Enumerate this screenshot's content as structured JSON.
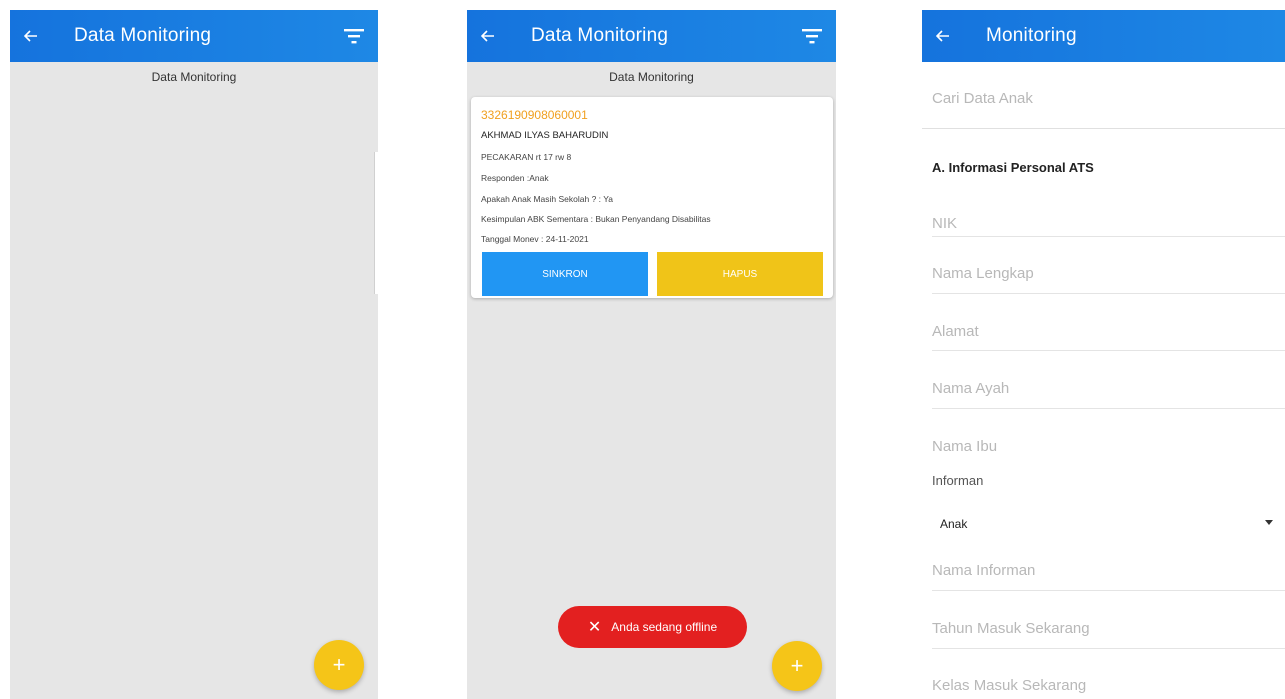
{
  "screen1": {
    "appbar": {
      "title": "Data Monitoring"
    },
    "subtitle": "Data Monitoring",
    "fab_label": "+"
  },
  "screen2": {
    "appbar": {
      "title": "Data Monitoring"
    },
    "subtitle": "Data Monitoring",
    "card": {
      "nik": "3326190908060001",
      "name": "AKHMAD ILYAS BAHARUDIN",
      "address": "PECAKARAN rt 17 rw 8",
      "responden": "Responden :Anak",
      "sekolah": "Apakah Anak Masih Sekolah ? : Ya",
      "kesimpulan": "Kesimpulan ABK Sementara : Bukan Penyandang Disabilitas",
      "tanggal": "Tanggal Monev : 24-11-2021",
      "sync_label": "SINKRON",
      "delete_label": "HAPUS"
    },
    "snackbar": {
      "icon": "✕",
      "text": "Anda sedang offline"
    },
    "fab_label": "+"
  },
  "screen3": {
    "appbar": {
      "title": "Monitoring"
    },
    "search_placeholder": "Cari Data Anak",
    "section_title": "A. Informasi Personal ATS",
    "fields": {
      "nik": "NIK",
      "nama_lengkap": "Nama Lengkap",
      "alamat": "Alamat",
      "nama_ayah": "Nama Ayah",
      "nama_ibu": "Nama Ibu"
    },
    "informan_label": "Informan",
    "informan_value": "Anak",
    "fields2": {
      "nama_informan": "Nama Informan",
      "tahun_masuk": "Tahun Masuk Sekarang",
      "kelas_masuk": "Kelas Masuk Sekarang"
    }
  },
  "colors": {
    "appbar": "#1e88e5",
    "fab": "#f5c518",
    "nik_text": "#f0a020",
    "sync_button": "#2196f3",
    "delete_button": "#f0c418",
    "snackbar": "#e32020"
  },
  "icons": {
    "back": "arrow-left-icon",
    "filter": "filter-icon",
    "add": "plus-icon",
    "close": "close-icon",
    "dropdown": "caret-down-icon"
  }
}
